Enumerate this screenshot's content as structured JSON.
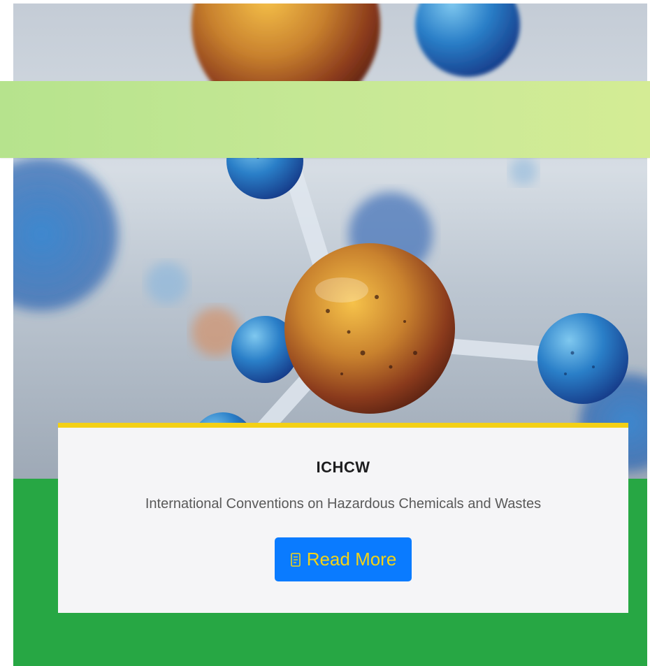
{
  "card": {
    "hero_image": "molecule-illustration",
    "title": "ICHCW",
    "description": "International Conventions on Hazardous Chemicals and Wastes",
    "button": {
      "label": "Read More",
      "icon": "book-icon"
    }
  },
  "colors": {
    "banner_start": "#b6e38d",
    "banner_end": "#d4ec95",
    "footer_green": "#27a744",
    "accent_yellow": "#f4d015",
    "button_blue": "#0a7bff",
    "button_text": "#f3d316"
  }
}
